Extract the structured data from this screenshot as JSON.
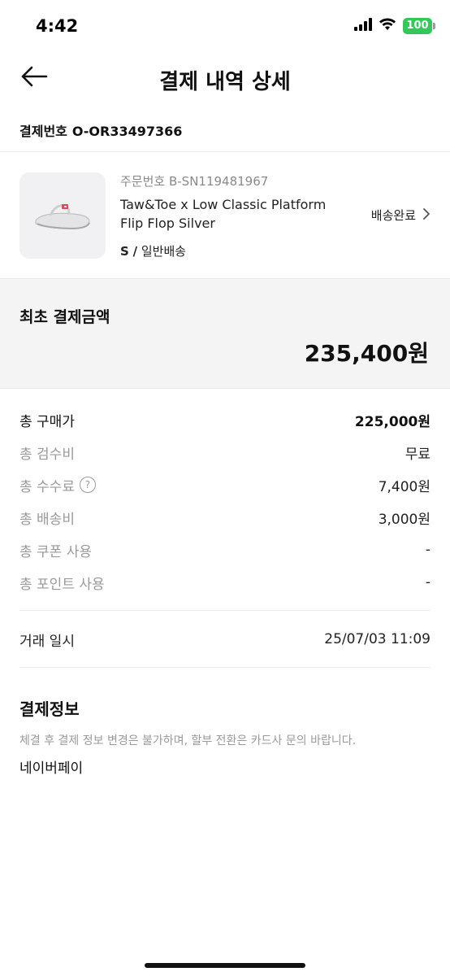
{
  "status_bar": {
    "time": "4:42",
    "battery": "100",
    "icons": [
      "cellular-signal-icon",
      "wifi-icon",
      "battery-icon"
    ]
  },
  "header": {
    "title": "결제 내역 상세",
    "back_icon": "arrow-left-icon"
  },
  "payment_number": {
    "label": "결제번호",
    "value": "O-OR33497366"
  },
  "order": {
    "order_number": "주문번호 B-SN119481967",
    "product_name": "Taw&Toe x Low Classic Platform Flip Flop Silver",
    "size": "S",
    "separator": "/",
    "shipping_type": "일반배송",
    "status": "배송완료",
    "thumbnail_icon": "flip-flop-sandal-icon"
  },
  "summary": {
    "label": "최초 결제금액",
    "amount": "235,400원"
  },
  "details": [
    {
      "label": "총 구매가",
      "value": "225,000원"
    },
    {
      "label": "총 검수비",
      "value": "무료"
    },
    {
      "label": "총 수수료",
      "value": "7,400원",
      "help": "?"
    },
    {
      "label": "총 배송비",
      "value": "3,000원"
    },
    {
      "label": "총 쿠폰 사용",
      "value": "-"
    },
    {
      "label": "총 포인트 사용",
      "value": "-"
    }
  ],
  "trade": {
    "label": "거래 일시",
    "value": "25/07/03 11:09"
  },
  "payment_info": {
    "title": "결제정보",
    "notice": "체결 후 결제 정보 변경은 불가하며, 할부 전환은 카드사 문의 바랍니다.",
    "method": "네이버페이"
  },
  "colors": {
    "summary_bg": "#f4f4f4",
    "muted_text": "#9a9a9a",
    "battery_green": "#34c759"
  }
}
